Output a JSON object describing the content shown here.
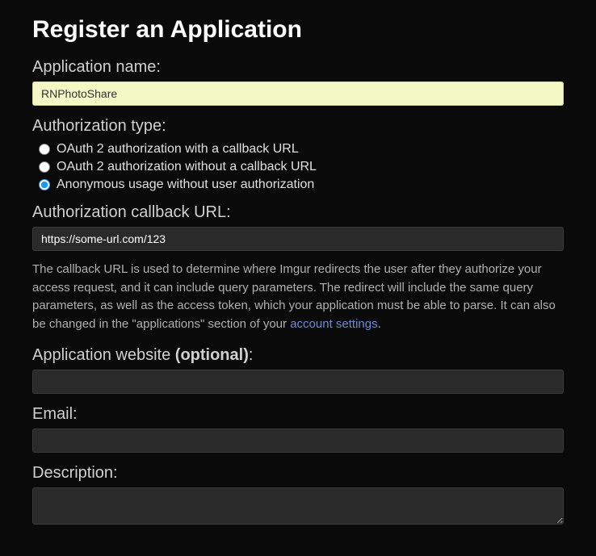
{
  "page_title": "Register an Application",
  "fields": {
    "app_name": {
      "label": "Application name:",
      "value": "RNPhotoShare"
    },
    "auth_type": {
      "label": "Authorization type:",
      "options": [
        "OAuth 2 authorization with a callback URL",
        "OAuth 2 authorization without a callback URL",
        "Anonymous usage without user authorization"
      ],
      "selected_index": 2
    },
    "callback_url": {
      "label": "Authorization callback URL:",
      "value": "https://some-url.com/123"
    },
    "callback_help": {
      "text_before": "The callback URL is used to determine where Imgur redirects the user after they authorize your access request, and it can include query parameters. The redirect will include the same query parameters, as well as the access token, which your application must be able to parse. It can also be changed in the \"applications\" section of your ",
      "link_text": "account settings",
      "text_after": "."
    },
    "website": {
      "label_prefix": "Application website ",
      "label_optional": "(optional)",
      "label_suffix": ":",
      "value": ""
    },
    "email": {
      "label": "Email:",
      "value": ""
    },
    "description": {
      "label": "Description:",
      "value": ""
    }
  }
}
